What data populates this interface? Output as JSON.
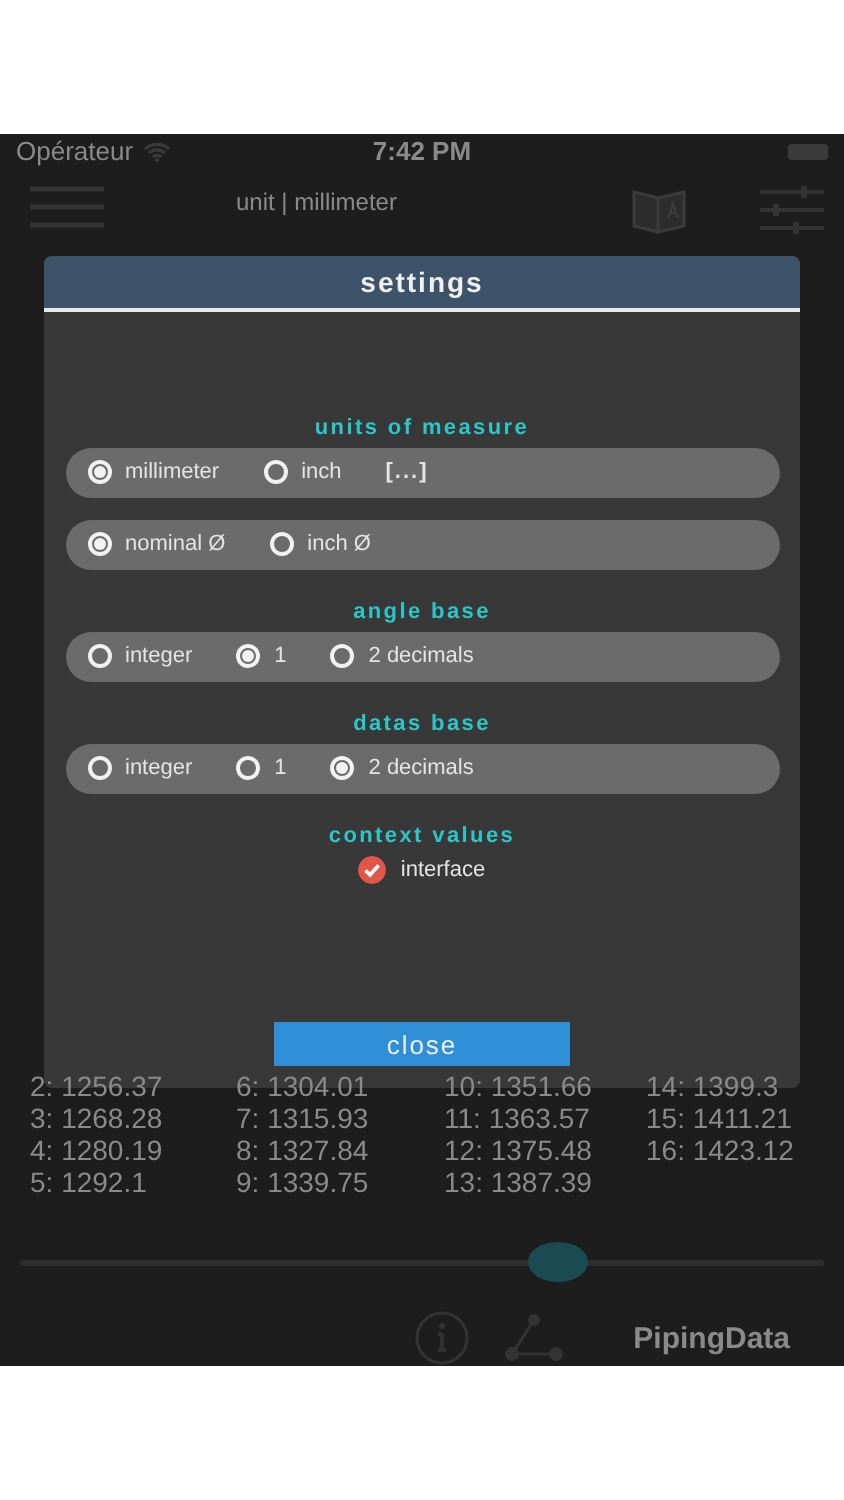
{
  "status_bar": {
    "carrier": "Opérateur",
    "time": "7:42 PM"
  },
  "top_bar": {
    "subtitle": "unit | millimeter"
  },
  "settings_dialog": {
    "title": "settings",
    "sections": [
      {
        "title": "units of measure",
        "rows": [
          [
            {
              "label": "millimeter",
              "selected": true
            },
            {
              "label": "inch",
              "selected": false
            },
            {
              "kind": "link",
              "label": "[...]"
            }
          ],
          [
            {
              "label": "nominal Ø",
              "selected": true
            },
            {
              "label": "inch Ø",
              "selected": false
            }
          ]
        ]
      },
      {
        "title": "angle base",
        "rows": [
          [
            {
              "label": "integer",
              "selected": false
            },
            {
              "label": "1",
              "selected": true
            },
            {
              "label": "2 decimals",
              "selected": false
            }
          ]
        ]
      },
      {
        "title": "datas base",
        "rows": [
          [
            {
              "label": "integer",
              "selected": false
            },
            {
              "label": "1",
              "selected": false
            },
            {
              "label": "2 decimals",
              "selected": true
            }
          ]
        ]
      }
    ],
    "context": {
      "title": "context values",
      "label": "interface",
      "checked": true
    },
    "close_button": "close"
  },
  "results": [
    [
      "2: 1256.37",
      "6: 1304.01",
      "10: 1351.66",
      "14: 1399.3"
    ],
    [
      "3: 1268.28",
      "7: 1315.93",
      "11: 1363.57",
      "15: 1411.21"
    ],
    [
      "4: 1280.19",
      "8: 1327.84",
      "12: 1375.48",
      "16: 1423.12"
    ],
    [
      "5: 1292.1",
      "9: 1339.75",
      "13: 1387.39"
    ]
  ],
  "slider": {
    "level": 0.67
  },
  "footer": {
    "app_name": "PipingData"
  }
}
